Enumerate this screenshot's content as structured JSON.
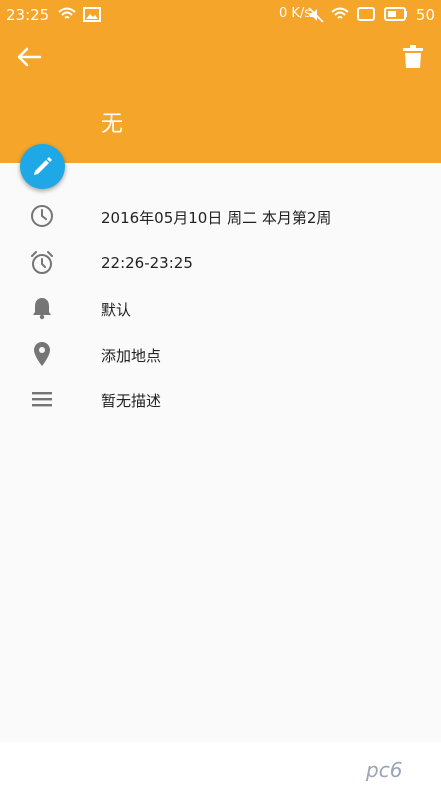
{
  "status_bar": {
    "time": "23:25",
    "net_speed": "0 K/s",
    "battery": "50"
  },
  "header": {
    "title": "无",
    "accent_color": "#f4a52a",
    "back_icon": "arrow-left-icon",
    "delete_icon": "trash-icon"
  },
  "fab": {
    "icon": "pencil-icon",
    "color": "#1ea8e6"
  },
  "details": [
    {
      "icon": "clock-icon",
      "text": "2016年05月10日  周二  本月第2周"
    },
    {
      "icon": "alarm-icon",
      "text": "22:26-23:25"
    },
    {
      "icon": "bell-icon",
      "text": "默认"
    },
    {
      "icon": "location-pin-icon",
      "text": "添加地点"
    },
    {
      "icon": "menu-lines-icon",
      "text": "暂无描述"
    }
  ],
  "watermark": "pc6"
}
